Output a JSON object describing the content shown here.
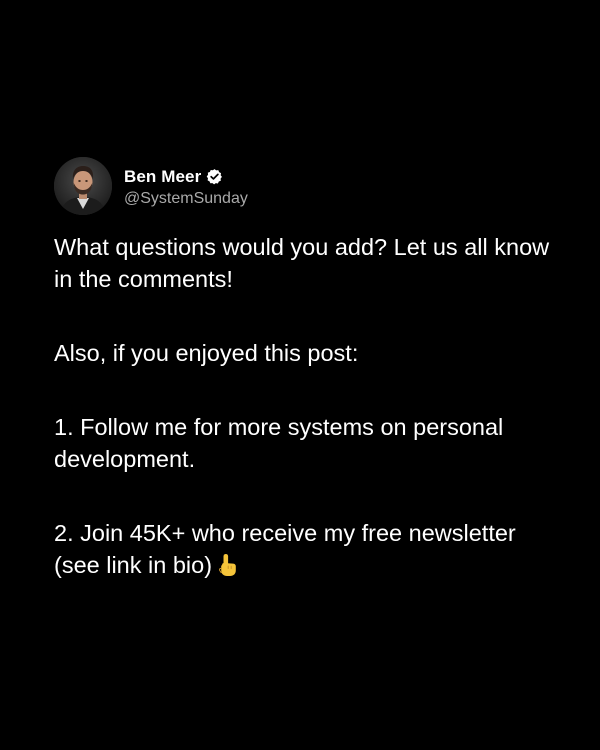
{
  "author": {
    "display_name": "Ben Meer",
    "handle": "@SystemSunday",
    "verified": true
  },
  "post": {
    "paragraph_1": "What questions would you add? Let us all know in the comments!",
    "paragraph_2": "Also, if you enjoyed this post:",
    "paragraph_3": "1. Follow me for more systems on personal development.",
    "paragraph_4": "2. Join 45K+ who receive my free newsletter (see link in bio)"
  },
  "icons": {
    "verified_badge": "verified-check-icon",
    "pointing_emoji": "pointing-up-hand-icon"
  },
  "colors": {
    "background": "#000000",
    "text": "#ffffff",
    "handle": "#a9a9a9",
    "emoji": "#f5c43a"
  }
}
